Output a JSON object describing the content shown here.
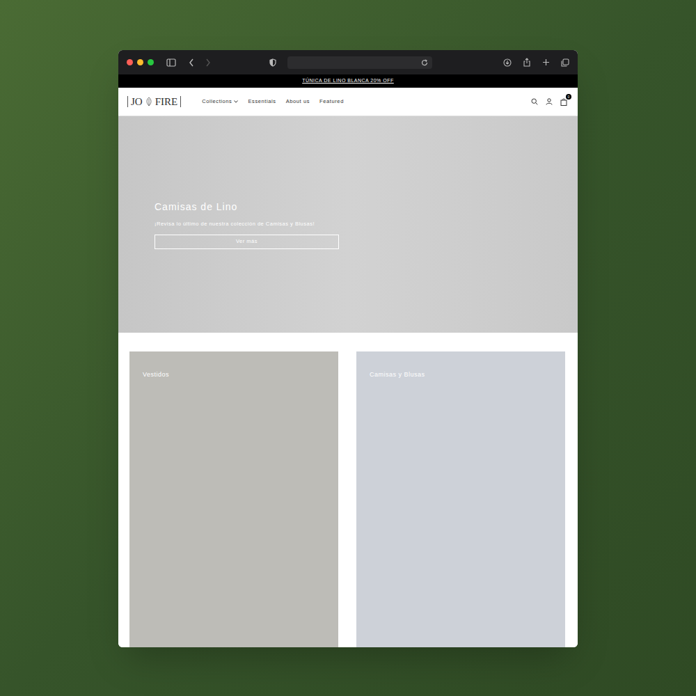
{
  "announcement": "TÚNICA DE LINO BLANCA 20% OFF",
  "logo": {
    "left": "JO",
    "right": "FIRE"
  },
  "nav": [
    {
      "label": "Collections",
      "dropdown": true
    },
    {
      "label": "Essentials",
      "dropdown": false
    },
    {
      "label": "About us",
      "dropdown": false
    },
    {
      "label": "Featured",
      "dropdown": false
    }
  ],
  "cart": {
    "count": "0"
  },
  "hero": {
    "title": "Camisas de Lino",
    "subtitle": "¡Revisa lo último de nuestra colección de Camisas y Blusas!",
    "button": "Ver más"
  },
  "categories": [
    {
      "label": "Vestidos",
      "color": "#bdbcb7"
    },
    {
      "label": "Camisas y Blusas",
      "color": "#cdd1d8"
    }
  ]
}
